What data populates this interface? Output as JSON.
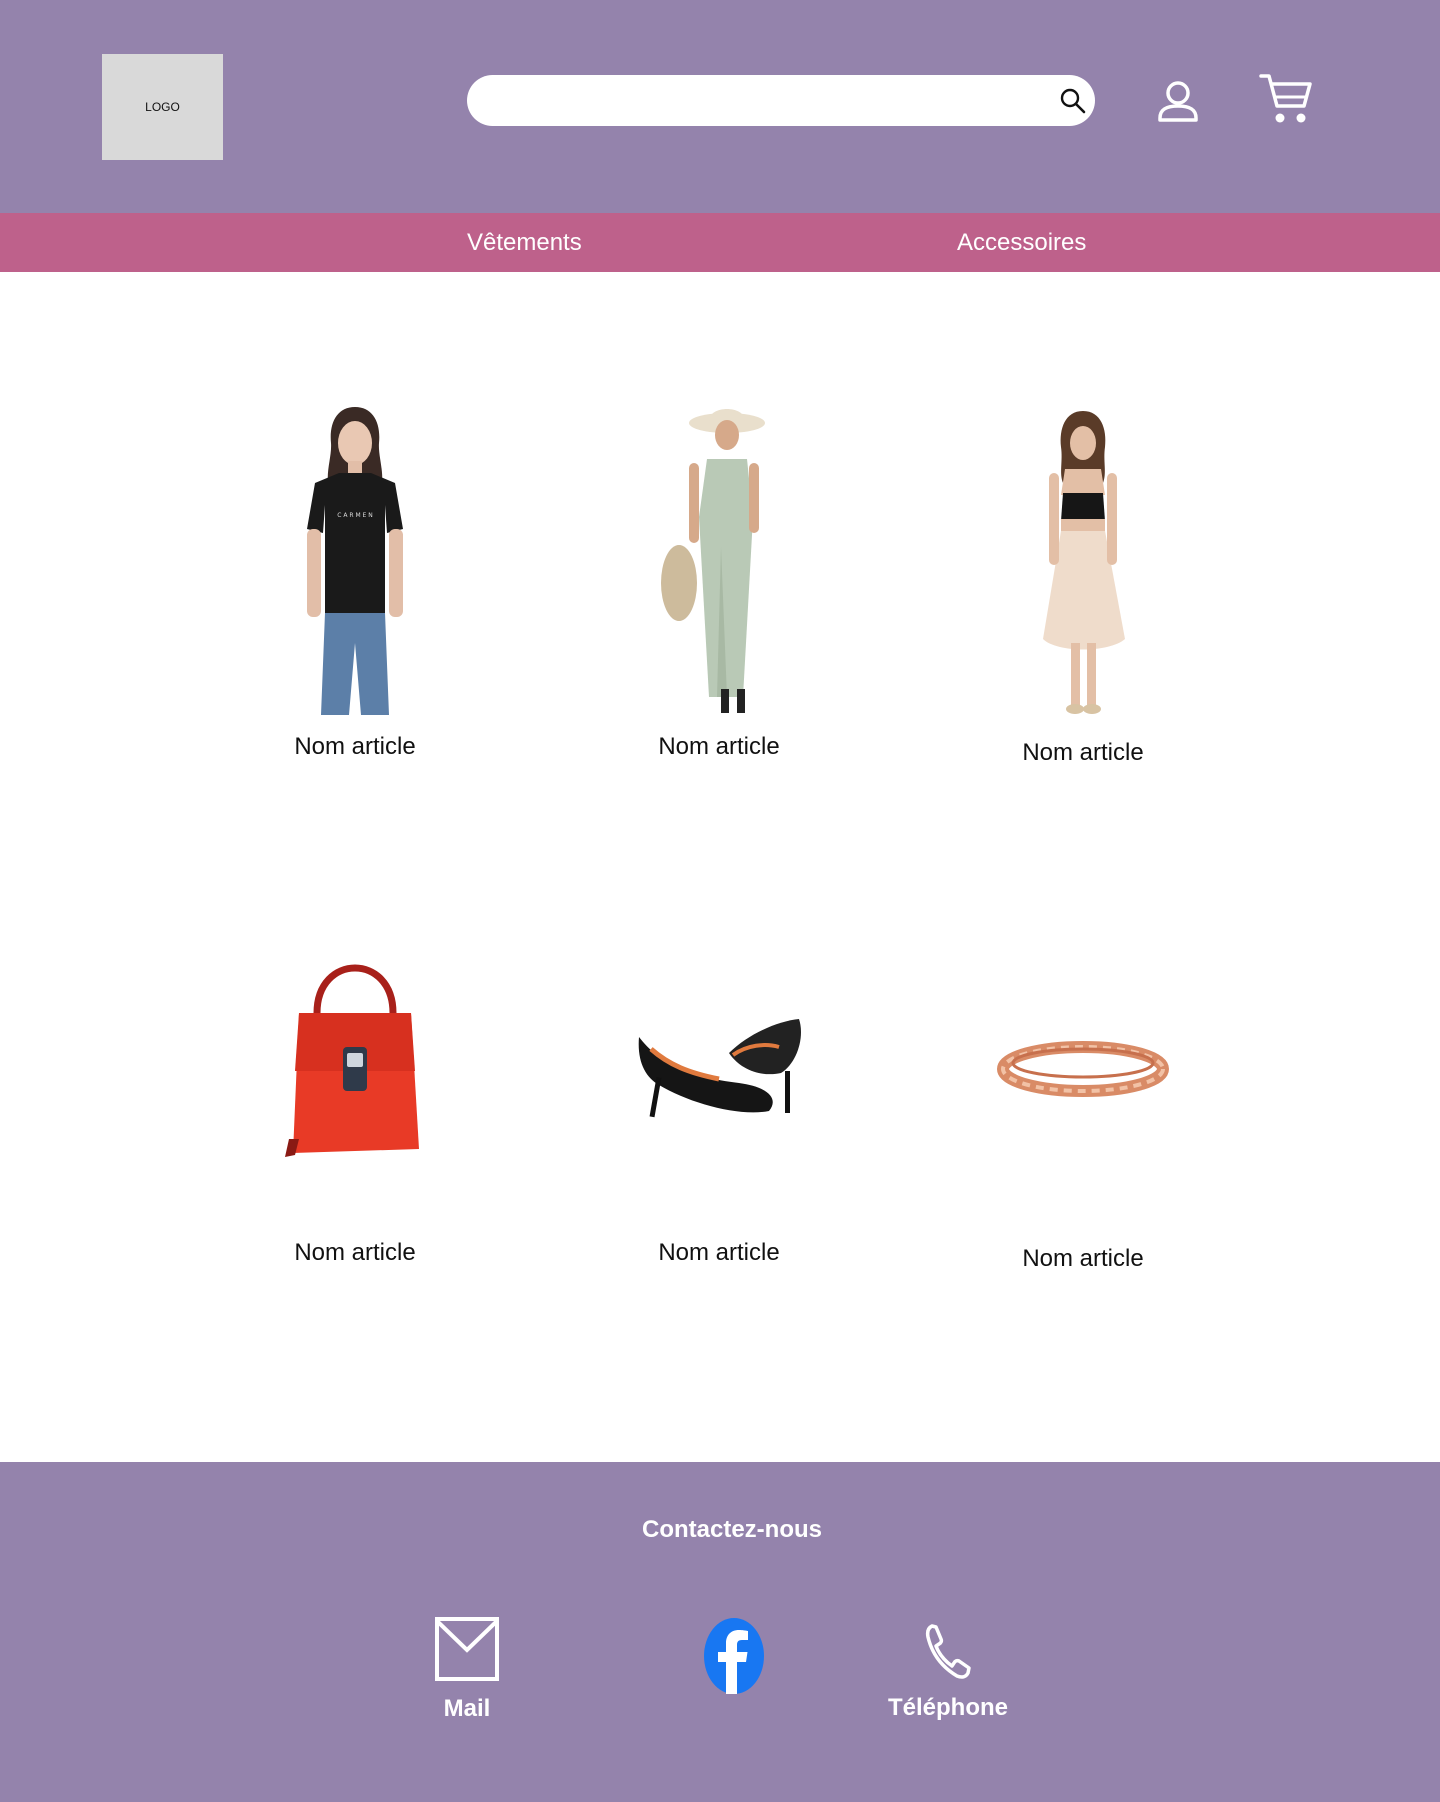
{
  "header": {
    "logo_text": "LOGO",
    "search": {
      "value": "",
      "placeholder": ""
    },
    "icons": {
      "search": "search-icon",
      "account": "user-icon",
      "cart": "cart-icon"
    }
  },
  "nav": {
    "items": [
      {
        "label": "Vêtements"
      },
      {
        "label": "Accessoires"
      }
    ]
  },
  "products": [
    {
      "name": "Nom article",
      "image": "woman-black-tshirt-jeans"
    },
    {
      "name": "Nom article",
      "image": "woman-sage-maxi-dress-hat"
    },
    {
      "name": "Nom article",
      "image": "woman-black-crop-top-skirt"
    },
    {
      "name": "Nom article",
      "image": "red-handbag"
    },
    {
      "name": "Nom article",
      "image": "black-heels"
    },
    {
      "name": "Nom article",
      "image": "rose-gold-bracelet"
    }
  ],
  "footer": {
    "title": "Contactez-nous",
    "contacts": [
      {
        "label": "Mail",
        "icon": "mail-icon"
      },
      {
        "label": "",
        "icon": "facebook-icon"
      },
      {
        "label": "Téléphone",
        "icon": "phone-icon"
      }
    ]
  },
  "colors": {
    "header_bg": "#9483AC",
    "nav_bg": "#BE618B",
    "footer_bg": "#9483AC",
    "logo_bg": "#D9D9D9",
    "facebook_blue": "#1877F2"
  }
}
